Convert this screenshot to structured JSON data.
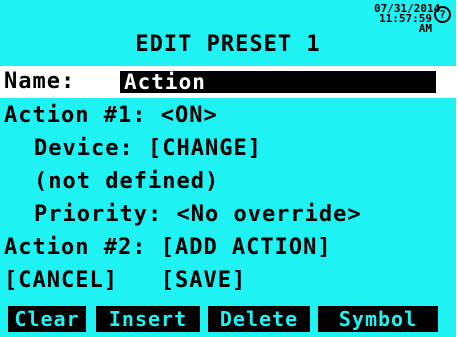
{
  "status": {
    "date": "07/31/2014",
    "time": "11:57:59",
    "meridiem": "AM",
    "help_icon": "question-circle-icon"
  },
  "title": "EDIT PRESET 1",
  "name": {
    "label": "Name:",
    "value": "Action"
  },
  "action1": {
    "label": "Action #1:",
    "value": "<ON>",
    "device_label": "Device:",
    "device_action": "[CHANGE]",
    "device_value": "(not defined)",
    "priority_label": "Priority:",
    "priority_value": "<No override>"
  },
  "action2": {
    "label": "Action #2:",
    "action": "[ADD ACTION]"
  },
  "buttons": {
    "cancel": "[CANCEL]",
    "save": "[SAVE]"
  },
  "softkeys": [
    "Clear",
    "Insert",
    "Delete",
    "Symbol"
  ],
  "colors": {
    "screen": "#1ff2f2",
    "highlight": "#ffffff",
    "field": "#000000"
  }
}
